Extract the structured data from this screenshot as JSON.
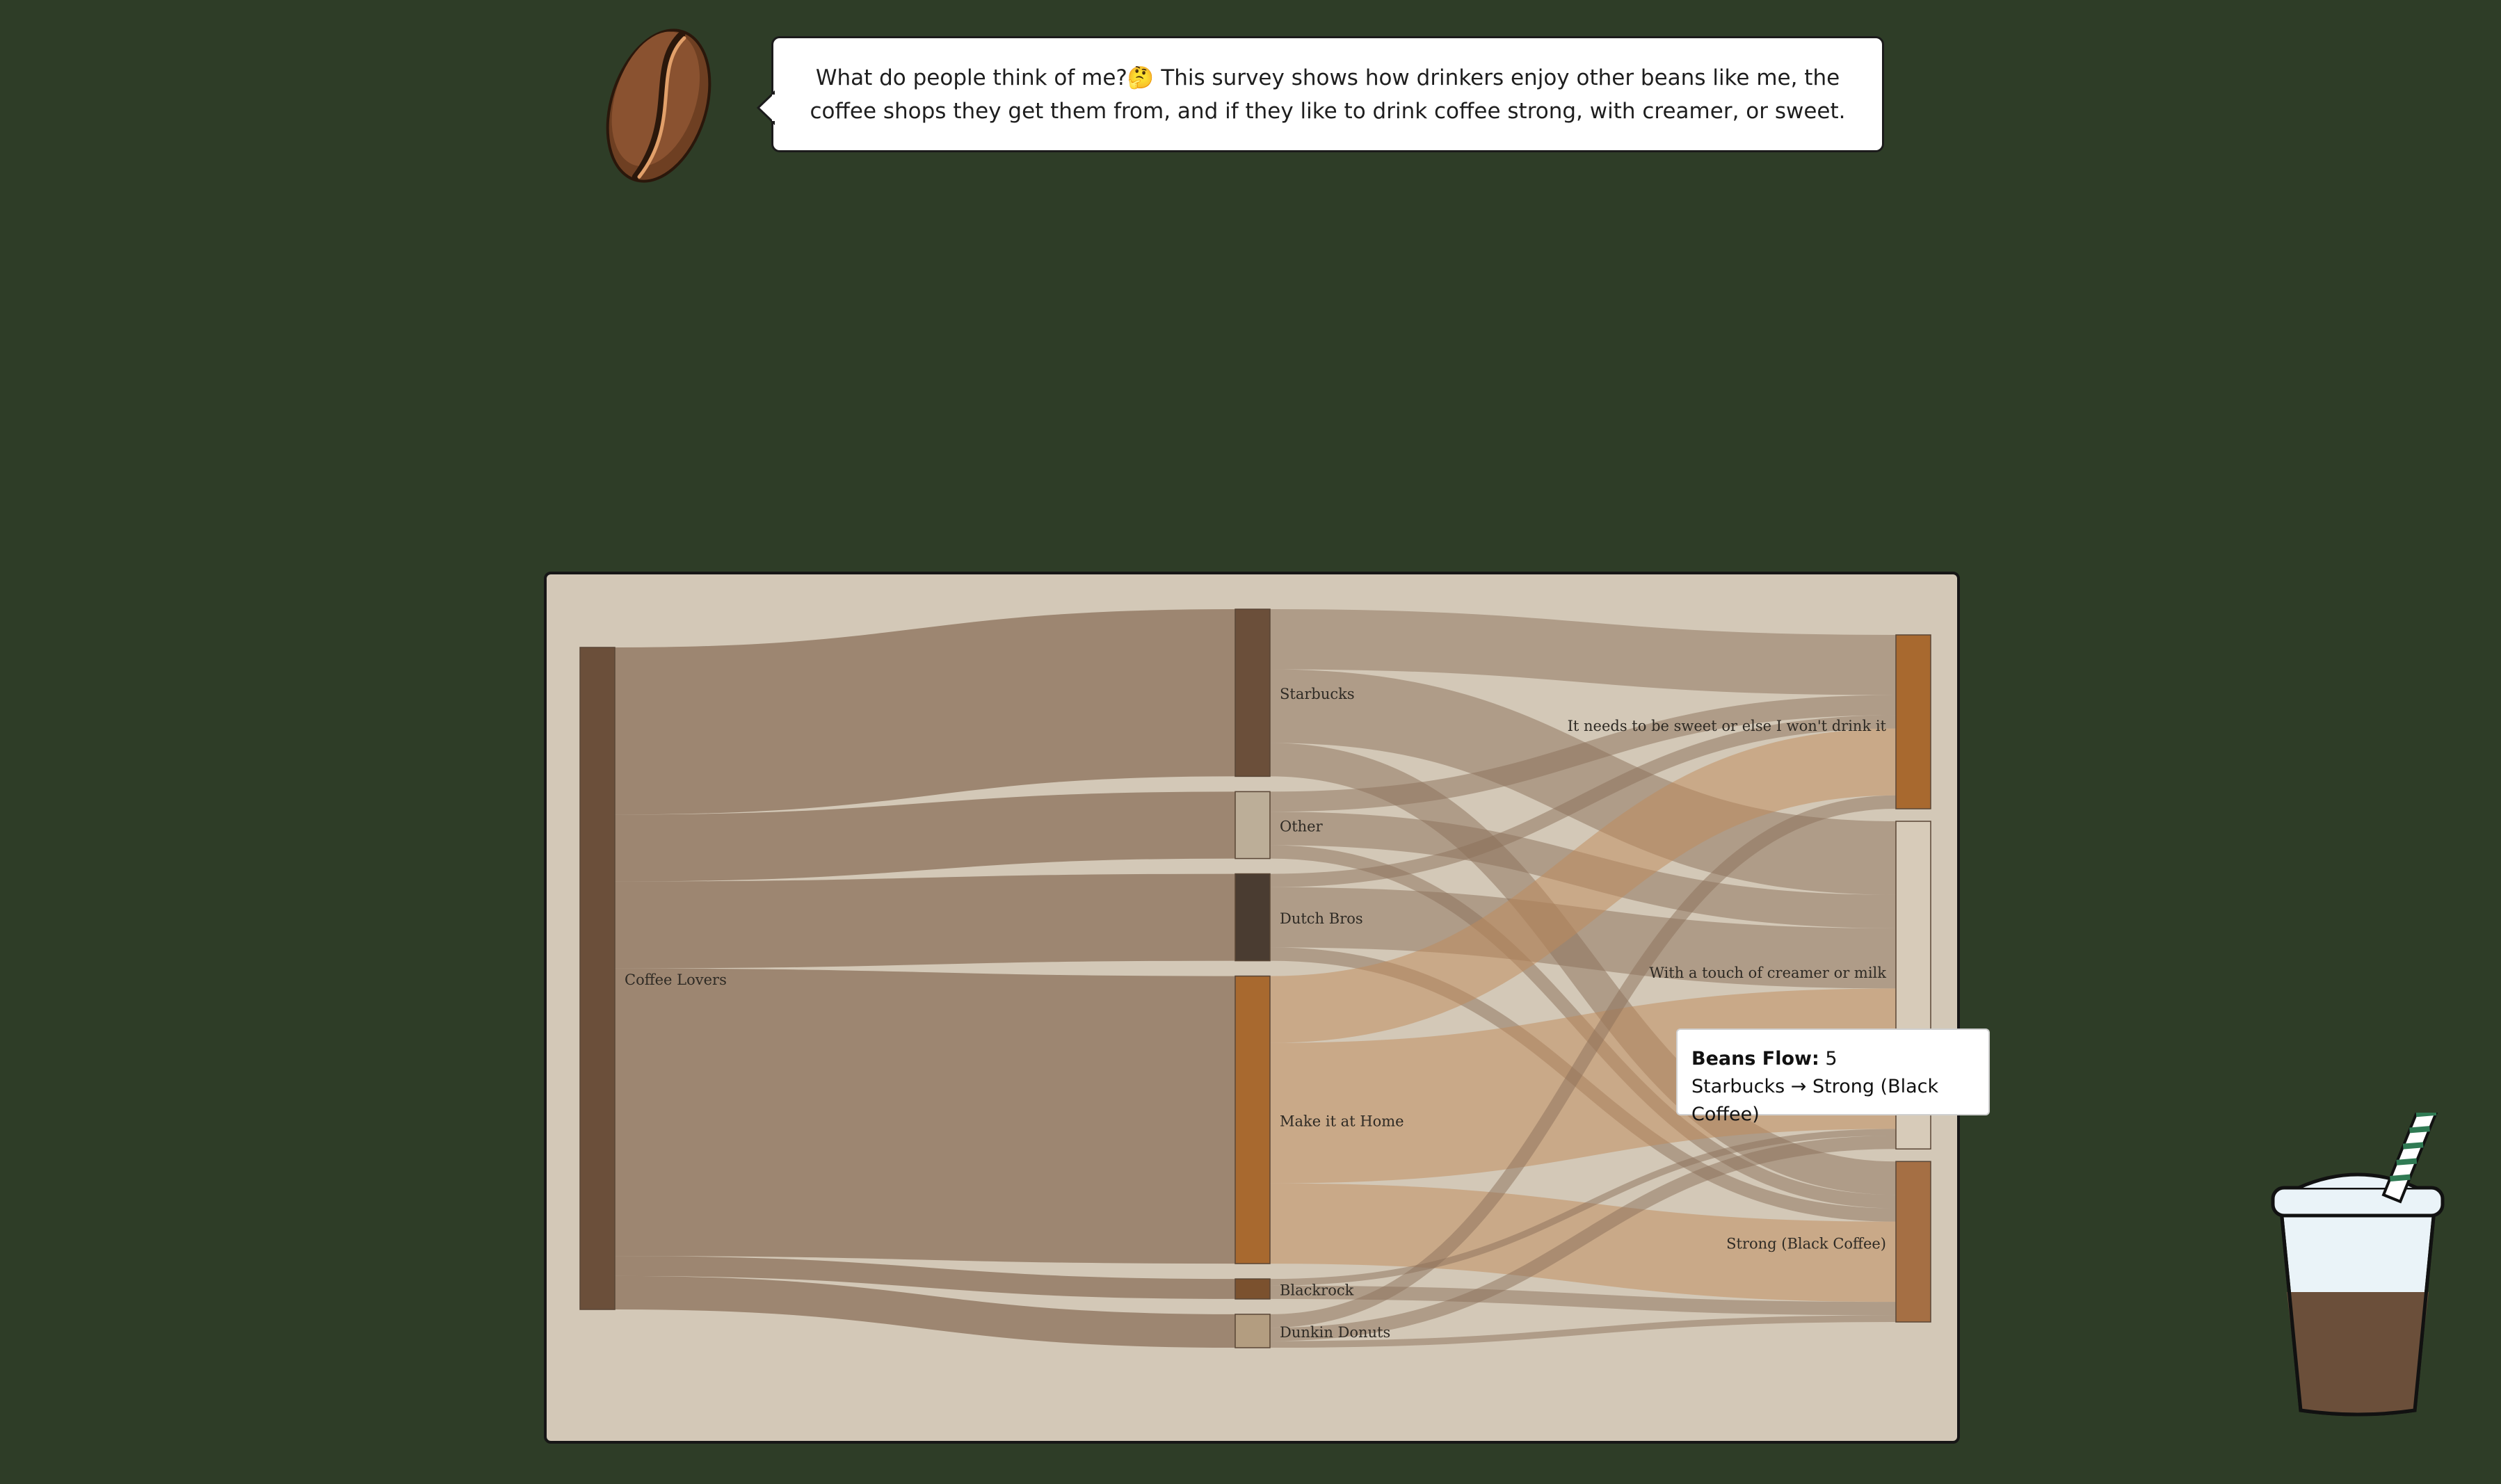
{
  "header": {
    "mascot_icon": "coffee-bean-icon",
    "speech_text": "What do people think of me?🤔 This survey shows how drinkers enjoy other beans like me, the coffee shops they get them from, and if they like to drink coffee strong, with creamer, or sweet."
  },
  "colors": {
    "background": "#2e3d27",
    "panel": "#d3c8b7",
    "link": "#8b705a",
    "starbucks": "#6b4f3a",
    "other": "#bcae98",
    "dutch_bros": "#4a3c31",
    "make_at_home": "#a8692f",
    "blackrock": "#7b512e",
    "dunkin": "#b39d80",
    "sweet": "#a8692f",
    "creamer": "#d7cbb9",
    "strong": "#a56f44"
  },
  "chart_data": {
    "type": "sankey",
    "nodes": [
      {
        "id": "coffee_lovers",
        "label": "Coffee Lovers"
      },
      {
        "id": "starbucks",
        "label": "Starbucks"
      },
      {
        "id": "other",
        "label": "Other"
      },
      {
        "id": "dutch_bros",
        "label": "Dutch Bros"
      },
      {
        "id": "make_at_home",
        "label": "Make it at Home"
      },
      {
        "id": "blackrock",
        "label": "Blackrock"
      },
      {
        "id": "dunkin_donuts",
        "label": "Dunkin Donuts"
      },
      {
        "id": "sweet",
        "label": "It needs to be sweet or else I won't drink it"
      },
      {
        "id": "creamer",
        "label": "With a touch of creamer or milk"
      },
      {
        "id": "strong",
        "label": "Strong (Black Coffee)"
      }
    ],
    "links": [
      {
        "source": "coffee_lovers",
        "target": "starbucks",
        "value": 25
      },
      {
        "source": "coffee_lovers",
        "target": "other",
        "value": 10
      },
      {
        "source": "coffee_lovers",
        "target": "dutch_bros",
        "value": 13
      },
      {
        "source": "coffee_lovers",
        "target": "make_at_home",
        "value": 43
      },
      {
        "source": "coffee_lovers",
        "target": "blackrock",
        "value": 3
      },
      {
        "source": "coffee_lovers",
        "target": "dunkin_donuts",
        "value": 5
      },
      {
        "source": "starbucks",
        "target": "sweet",
        "value": 9
      },
      {
        "source": "starbucks",
        "target": "creamer",
        "value": 11
      },
      {
        "source": "starbucks",
        "target": "strong",
        "value": 5
      },
      {
        "source": "other",
        "target": "sweet",
        "value": 3
      },
      {
        "source": "other",
        "target": "creamer",
        "value": 5
      },
      {
        "source": "other",
        "target": "strong",
        "value": 2
      },
      {
        "source": "dutch_bros",
        "target": "sweet",
        "value": 2
      },
      {
        "source": "dutch_bros",
        "target": "creamer",
        "value": 9
      },
      {
        "source": "dutch_bros",
        "target": "strong",
        "value": 2
      },
      {
        "source": "make_at_home",
        "target": "sweet",
        "value": 10
      },
      {
        "source": "make_at_home",
        "target": "creamer",
        "value": 21
      },
      {
        "source": "make_at_home",
        "target": "strong",
        "value": 12
      },
      {
        "source": "blackrock",
        "target": "creamer",
        "value": 1
      },
      {
        "source": "blackrock",
        "target": "strong",
        "value": 2
      },
      {
        "source": "dunkin_donuts",
        "target": "sweet",
        "value": 2
      },
      {
        "source": "dunkin_donuts",
        "target": "creamer",
        "value": 2
      },
      {
        "source": "dunkin_donuts",
        "target": "strong",
        "value": 1
      }
    ]
  },
  "tooltip": {
    "label": "Beans Flow:",
    "value": "5",
    "path": "Starbucks → Strong (Black Coffee)"
  },
  "decor": {
    "cup_icon": "iced-coffee-cup-icon"
  }
}
